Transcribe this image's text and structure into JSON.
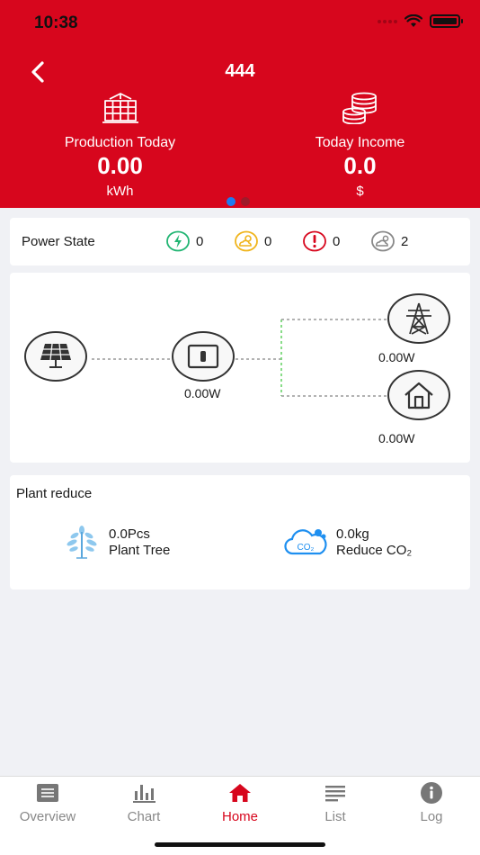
{
  "status_bar": {
    "time": "10:38"
  },
  "header": {
    "title": "444",
    "production": {
      "label": "Production Today",
      "value": "0.00",
      "unit": "kWh"
    },
    "income": {
      "label": "Today Income",
      "value": "0.0",
      "unit": "$"
    },
    "page_dot_active_color": "#1e7bf0",
    "page_dot_inactive_color": "#9e1b2a",
    "accent_color": "#d7061d"
  },
  "power_state": {
    "label": "Power State",
    "normal_count": "0",
    "waiting_count": "0",
    "fault_count": "0",
    "offline_count": "2"
  },
  "flow": {
    "inverter_power": "0.00W",
    "grid_power": "0.00W",
    "load_power": "0.00W"
  },
  "plant_reduce": {
    "title": "Plant reduce",
    "tree_value": "0.0Pcs",
    "tree_label": "Plant Tree",
    "co2_value": "0.0kg",
    "co2_label": "Reduce CO₂"
  },
  "tabs": [
    {
      "label": "Overview",
      "icon": "overview-icon"
    },
    {
      "label": "Chart",
      "icon": "chart-icon"
    },
    {
      "label": "Home",
      "icon": "home-icon",
      "active": true
    },
    {
      "label": "List",
      "icon": "list-icon"
    },
    {
      "label": "Log",
      "icon": "info-icon"
    }
  ]
}
